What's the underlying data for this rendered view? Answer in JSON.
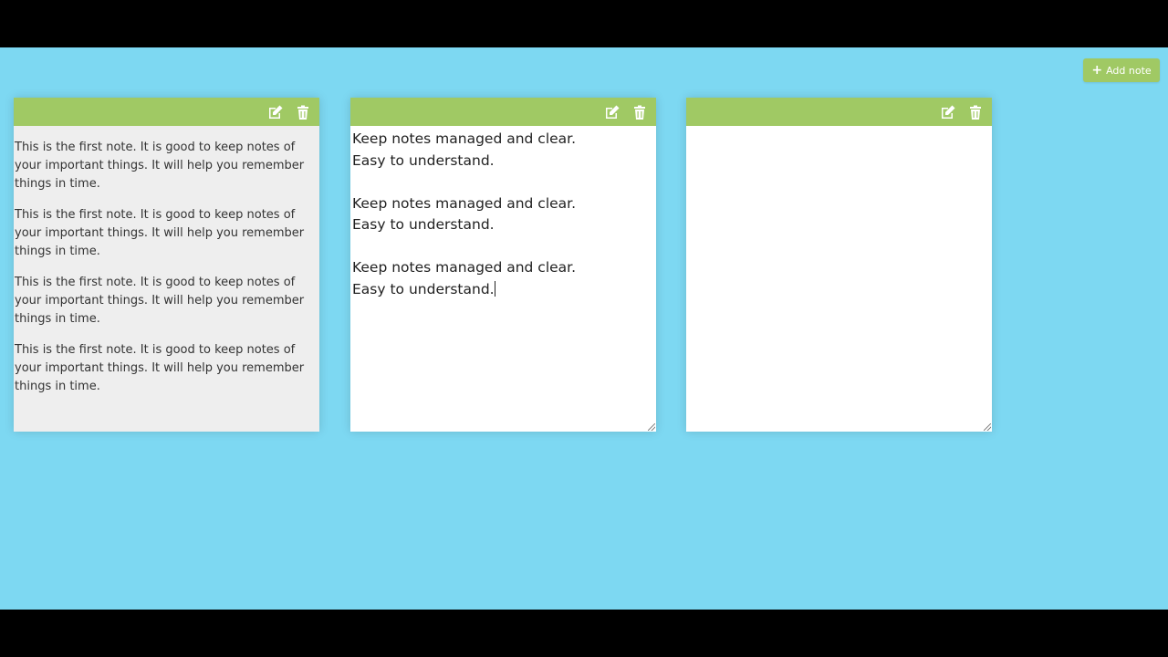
{
  "toolbar": {
    "add_note_label": "Add note",
    "accent_color": "#a0c964"
  },
  "background_color": "#7dd8f2",
  "notes": [
    {
      "mode": "preview",
      "paragraphs": [
        "This is the first note. It is good to keep notes of your important things. It will help you remember things in time.",
        "This is the first note. It is good to keep notes of your important things. It will help you remember things in time.",
        "This is the first note. It is good to keep notes of your important things. It will help you remember things in time.",
        "This is the first note. It is good to keep notes of your important things. It will help you remember things in time."
      ],
      "icons": [
        "edit-icon",
        "trash-icon"
      ]
    },
    {
      "mode": "editing",
      "text": "Keep notes managed and clear.\nEasy to understand.\n\nKeep notes managed and clear.\nEasy to understand.\n\nKeep notes managed and clear.\nEasy to understand.",
      "icons": [
        "edit-icon",
        "trash-icon"
      ]
    },
    {
      "mode": "editing",
      "text": "",
      "icons": [
        "edit-icon",
        "trash-icon"
      ]
    }
  ]
}
